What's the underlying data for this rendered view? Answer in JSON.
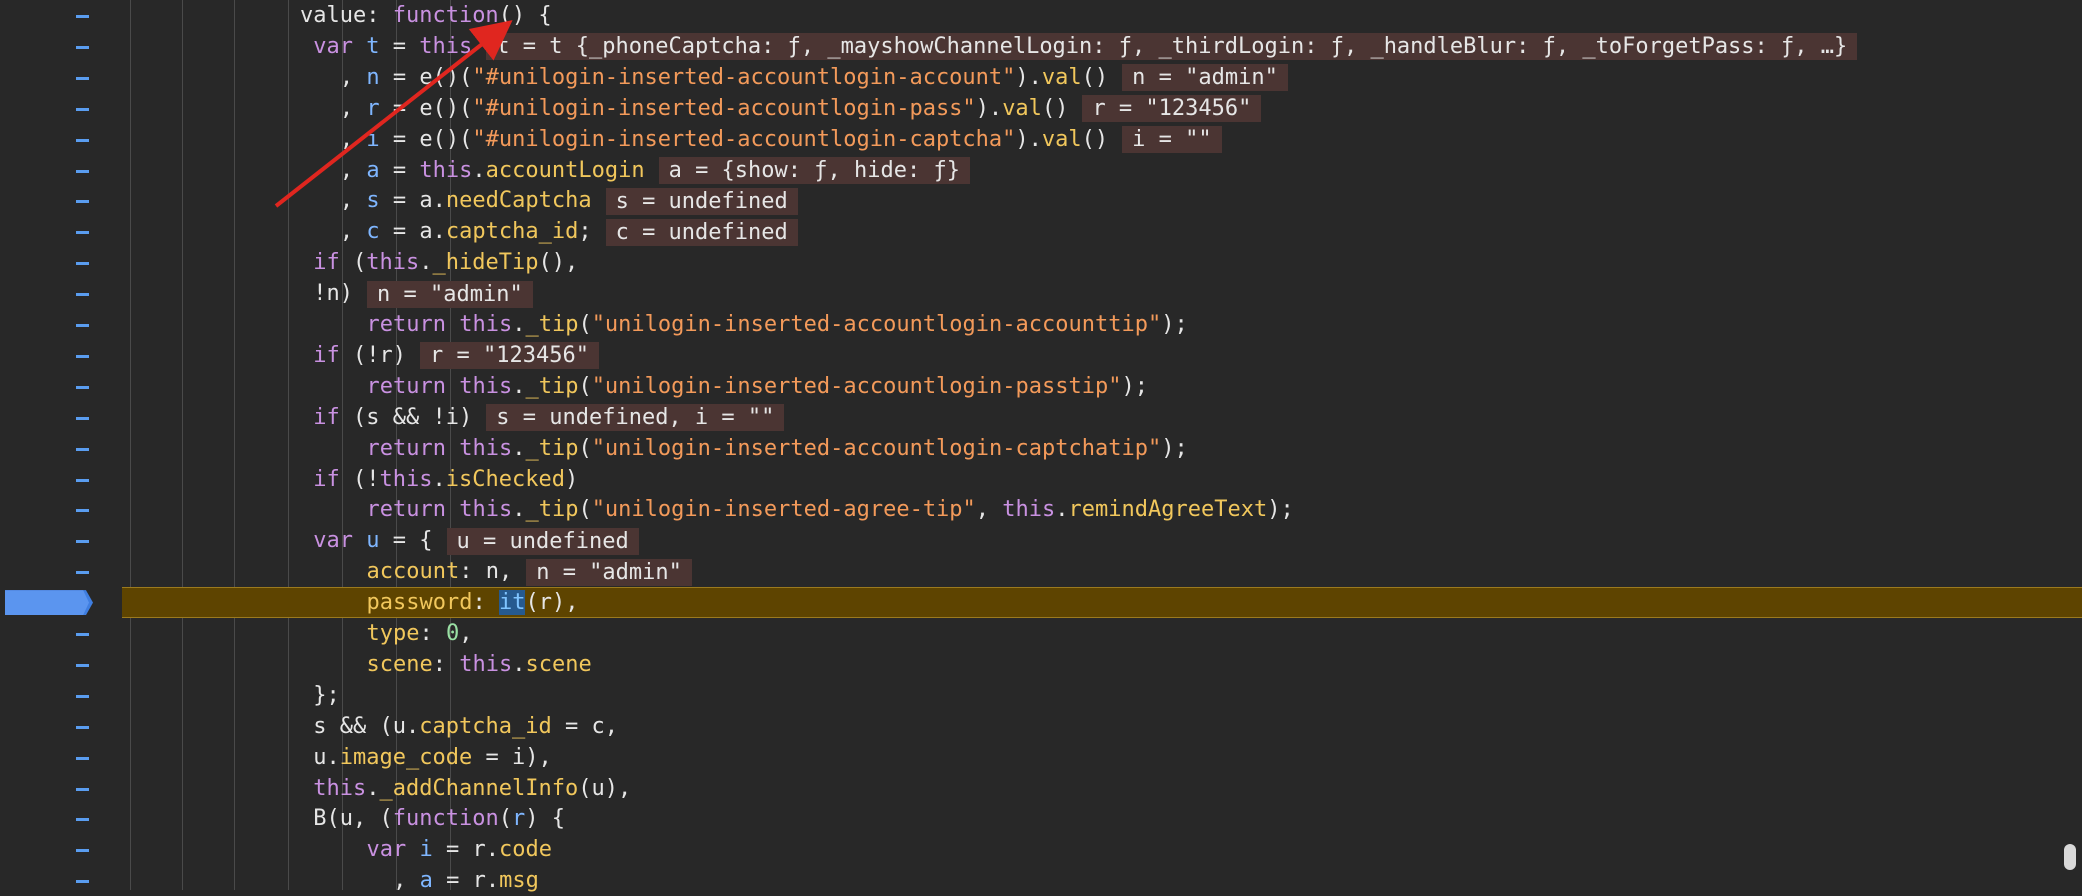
{
  "editor": {
    "lines": [
      {
        "ind": "    ",
        "toks": [
          [
            "plain",
            "value: "
          ],
          [
            "kw",
            "function"
          ],
          [
            "plain",
            "() {"
          ]
        ]
      },
      {
        "ind": "     ",
        "toks": [
          [
            "kw",
            "var "
          ],
          [
            "id",
            "t"
          ],
          [
            "plain",
            " = "
          ],
          [
            "kw",
            "this"
          ]
        ],
        "inline": "t = t {_phoneCaptcha: ƒ, _mayshowChannelLogin: ƒ, _thirdLogin: ƒ, _handleBlur: ƒ, _toForgetPass: ƒ, …}"
      },
      {
        "ind": "       ",
        "toks": [
          [
            "plain",
            ", "
          ],
          [
            "id",
            "n"
          ],
          [
            "plain",
            " = e()("
          ],
          [
            "str",
            "\"#unilogin-inserted-accountlogin-account\""
          ],
          [
            "plain",
            ")."
          ],
          [
            "prop",
            "val"
          ],
          [
            "plain",
            "()"
          ]
        ],
        "inline": "n = \"admin\""
      },
      {
        "ind": "       ",
        "toks": [
          [
            "plain",
            ", "
          ],
          [
            "id",
            "r"
          ],
          [
            "plain",
            " = e()("
          ],
          [
            "str",
            "\"#unilogin-inserted-accountlogin-pass\""
          ],
          [
            "plain",
            ")."
          ],
          [
            "prop",
            "val"
          ],
          [
            "plain",
            "()"
          ]
        ],
        "inline": "r = \"123456\""
      },
      {
        "ind": "       ",
        "toks": [
          [
            "plain",
            ", "
          ],
          [
            "id",
            "i"
          ],
          [
            "plain",
            " = e()("
          ],
          [
            "str",
            "\"#unilogin-inserted-accountlogin-captcha\""
          ],
          [
            "plain",
            ")."
          ],
          [
            "prop",
            "val"
          ],
          [
            "plain",
            "()"
          ]
        ],
        "inline": "i = \"\""
      },
      {
        "ind": "       ",
        "toks": [
          [
            "plain",
            ", "
          ],
          [
            "id",
            "a"
          ],
          [
            "plain",
            " = "
          ],
          [
            "kw",
            "this"
          ],
          [
            "plain",
            "."
          ],
          [
            "prop",
            "accountLogin"
          ]
        ],
        "inline": "a = {show: ƒ, hide: ƒ}"
      },
      {
        "ind": "       ",
        "toks": [
          [
            "plain",
            ", "
          ],
          [
            "id",
            "s"
          ],
          [
            "plain",
            " = a."
          ],
          [
            "prop",
            "needCaptcha"
          ]
        ],
        "inline": "s = undefined"
      },
      {
        "ind": "       ",
        "toks": [
          [
            "plain",
            ", "
          ],
          [
            "id",
            "c"
          ],
          [
            "plain",
            " = a."
          ],
          [
            "prop",
            "captcha_id"
          ],
          [
            "plain",
            ";"
          ]
        ],
        "inline": "c = undefined"
      },
      {
        "ind": "     ",
        "toks": [
          [
            "kw",
            "if"
          ],
          [
            "plain",
            " ("
          ],
          [
            "kw",
            "this"
          ],
          [
            "plain",
            "."
          ],
          [
            "prop",
            "_hideTip"
          ],
          [
            "plain",
            "(),"
          ]
        ]
      },
      {
        "ind": "     ",
        "toks": [
          [
            "plain",
            "!n)"
          ]
        ],
        "inline": "n = \"admin\""
      },
      {
        "ind": "         ",
        "toks": [
          [
            "kw",
            "return "
          ],
          [
            "kw",
            "this"
          ],
          [
            "plain",
            "."
          ],
          [
            "prop",
            "_tip"
          ],
          [
            "plain",
            "("
          ],
          [
            "str",
            "\"unilogin-inserted-accountlogin-accounttip\""
          ],
          [
            "plain",
            ");"
          ]
        ]
      },
      {
        "ind": "     ",
        "toks": [
          [
            "kw",
            "if"
          ],
          [
            "plain",
            " (!r)"
          ]
        ],
        "inline": "r = \"123456\""
      },
      {
        "ind": "         ",
        "toks": [
          [
            "kw",
            "return "
          ],
          [
            "kw",
            "this"
          ],
          [
            "plain",
            "."
          ],
          [
            "prop",
            "_tip"
          ],
          [
            "plain",
            "("
          ],
          [
            "str",
            "\"unilogin-inserted-accountlogin-passtip\""
          ],
          [
            "plain",
            ");"
          ]
        ]
      },
      {
        "ind": "     ",
        "toks": [
          [
            "kw",
            "if"
          ],
          [
            "plain",
            " (s && !i)"
          ]
        ],
        "inline": "s = undefined, i = \"\""
      },
      {
        "ind": "         ",
        "toks": [
          [
            "kw",
            "return "
          ],
          [
            "kw",
            "this"
          ],
          [
            "plain",
            "."
          ],
          [
            "prop",
            "_tip"
          ],
          [
            "plain",
            "("
          ],
          [
            "str",
            "\"unilogin-inserted-accountlogin-captchatip\""
          ],
          [
            "plain",
            ");"
          ]
        ]
      },
      {
        "ind": "     ",
        "toks": [
          [
            "kw",
            "if"
          ],
          [
            "plain",
            " (!"
          ],
          [
            "kw",
            "this"
          ],
          [
            "plain",
            "."
          ],
          [
            "prop",
            "isChecked"
          ],
          [
            "plain",
            ")"
          ]
        ]
      },
      {
        "ind": "         ",
        "toks": [
          [
            "kw",
            "return "
          ],
          [
            "kw",
            "this"
          ],
          [
            "plain",
            "."
          ],
          [
            "prop",
            "_tip"
          ],
          [
            "plain",
            "("
          ],
          [
            "str",
            "\"unilogin-inserted-agree-tip\""
          ],
          [
            "plain",
            ", "
          ],
          [
            "kw",
            "this"
          ],
          [
            "plain",
            "."
          ],
          [
            "prop",
            "remindAgreeText"
          ],
          [
            "plain",
            ");"
          ]
        ]
      },
      {
        "ind": "     ",
        "toks": [
          [
            "kw",
            "var "
          ],
          [
            "id",
            "u"
          ],
          [
            "plain",
            " = {"
          ]
        ],
        "inline": "u = undefined"
      },
      {
        "ind": "         ",
        "toks": [
          [
            "prop",
            "account"
          ],
          [
            "plain",
            ": n,"
          ]
        ],
        "inline": "n = \"admin\""
      },
      {
        "ind": "         ",
        "toks": [
          [
            "prop",
            "password"
          ],
          [
            "plain",
            ": "
          ],
          [
            "sel",
            "it"
          ],
          [
            "plain",
            "(r),"
          ]
        ],
        "current": true
      },
      {
        "ind": "         ",
        "toks": [
          [
            "prop",
            "type"
          ],
          [
            "plain",
            ": "
          ],
          [
            "num",
            "0"
          ],
          [
            "plain",
            ","
          ]
        ]
      },
      {
        "ind": "         ",
        "toks": [
          [
            "prop",
            "scene"
          ],
          [
            "plain",
            ": "
          ],
          [
            "kw",
            "this"
          ],
          [
            "plain",
            "."
          ],
          [
            "prop",
            "scene"
          ]
        ]
      },
      {
        "ind": "     ",
        "toks": [
          [
            "plain",
            "};"
          ]
        ]
      },
      {
        "ind": "     ",
        "toks": [
          [
            "plain",
            "s && (u."
          ],
          [
            "prop",
            "captcha_id"
          ],
          [
            "plain",
            " = c,"
          ]
        ]
      },
      {
        "ind": "     ",
        "toks": [
          [
            "plain",
            "u."
          ],
          [
            "prop",
            "image_code"
          ],
          [
            "plain",
            " = i),"
          ]
        ]
      },
      {
        "ind": "     ",
        "toks": [
          [
            "kw",
            "this"
          ],
          [
            "plain",
            "."
          ],
          [
            "prop",
            "_addChannelInfo"
          ],
          [
            "plain",
            "(u),"
          ]
        ]
      },
      {
        "ind": "     ",
        "toks": [
          [
            "plain",
            "B(u, ("
          ],
          [
            "kw",
            "function"
          ],
          [
            "plain",
            "("
          ],
          [
            "id",
            "r"
          ],
          [
            "plain",
            ") {"
          ]
        ]
      },
      {
        "ind": "         ",
        "toks": [
          [
            "kw",
            "var "
          ],
          [
            "id",
            "i"
          ],
          [
            "plain",
            " = r."
          ],
          [
            "prop",
            "code"
          ]
        ]
      },
      {
        "ind": "           ",
        "toks": [
          [
            "plain",
            ", "
          ],
          [
            "id",
            "a"
          ],
          [
            "plain",
            " = r."
          ],
          [
            "prop",
            "msg"
          ]
        ]
      }
    ]
  }
}
